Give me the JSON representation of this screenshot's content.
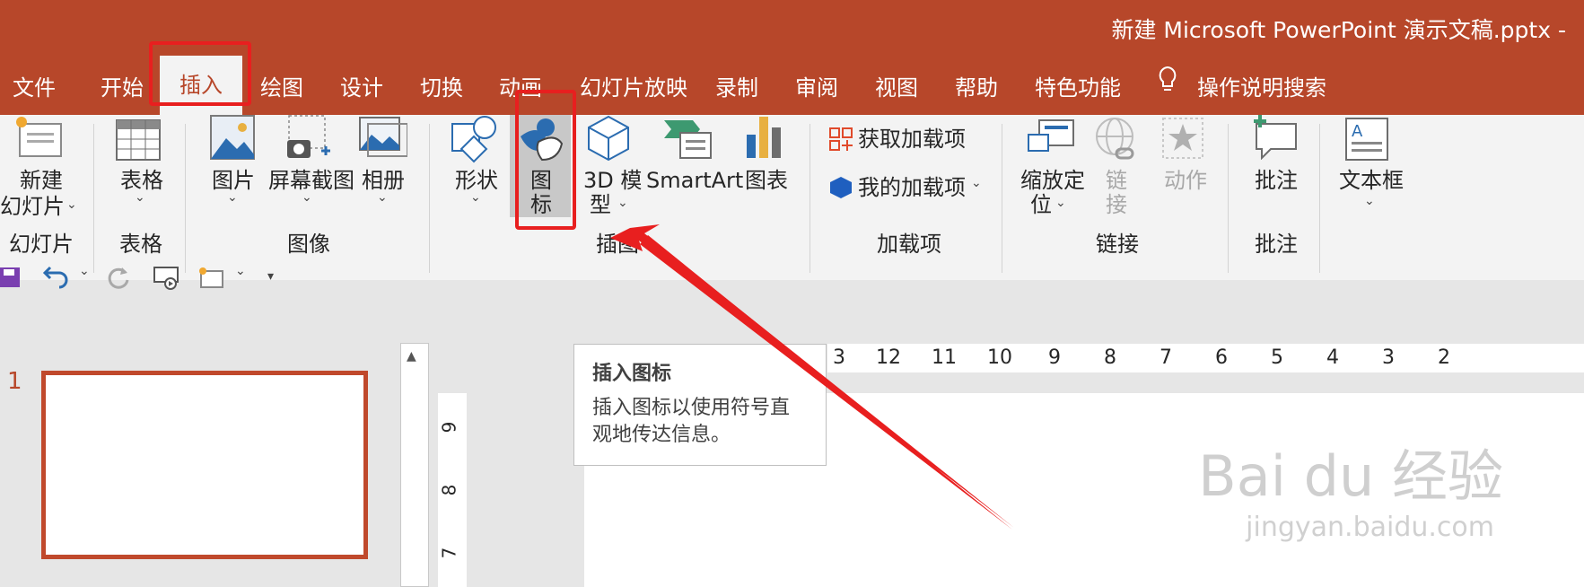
{
  "window": {
    "title": "新建 Microsoft PowerPoint 演示文稿.pptx  -"
  },
  "tabs": [
    "文件",
    "开始",
    "插入",
    "绘图",
    "设计",
    "切换",
    "动画",
    "幻灯片放映",
    "录制",
    "审阅",
    "视图",
    "帮助",
    "特色功能"
  ],
  "tell_me": "操作说明搜索",
  "ribbon": {
    "new_slide": [
      "新建",
      "幻灯片"
    ],
    "table": "表格",
    "picture": "图片",
    "screenshot": "屏幕截图",
    "album": "相册",
    "shapes": "形状",
    "icons": [
      "图",
      "标"
    ],
    "model3d": [
      "3D 模",
      "型"
    ],
    "smartart": "SmartArt",
    "chart": "图表",
    "get_addins": "获取加载项",
    "my_addins": "我的加载项",
    "zoom": [
      "缩放定",
      "位"
    ],
    "link": [
      "链",
      "接"
    ],
    "action": "动作",
    "comment": "批注",
    "textbox": "文本框",
    "groups": {
      "slides": "幻灯片",
      "tables": "表格",
      "images": "图像",
      "illustrations": "插图",
      "addins": "加载项",
      "links": "链接",
      "comments": "批注"
    }
  },
  "slide_number": "1",
  "ruler_h": [
    "3",
    "12",
    "11",
    "10",
    "9",
    "8",
    "7",
    "6",
    "5",
    "4",
    "3",
    "2"
  ],
  "ruler_v": [
    "9",
    "8",
    "7"
  ],
  "tooltip": {
    "title": "插入图标",
    "body_line1": "插入图标以使用符号直",
    "body_line2": "观地传达信息。"
  },
  "watermark": {
    "brand": "Bai du 经验",
    "url": "jingyan.baidu.com"
  },
  "colors": {
    "accent": "#b7472a",
    "highlight": "#e81f1f"
  }
}
